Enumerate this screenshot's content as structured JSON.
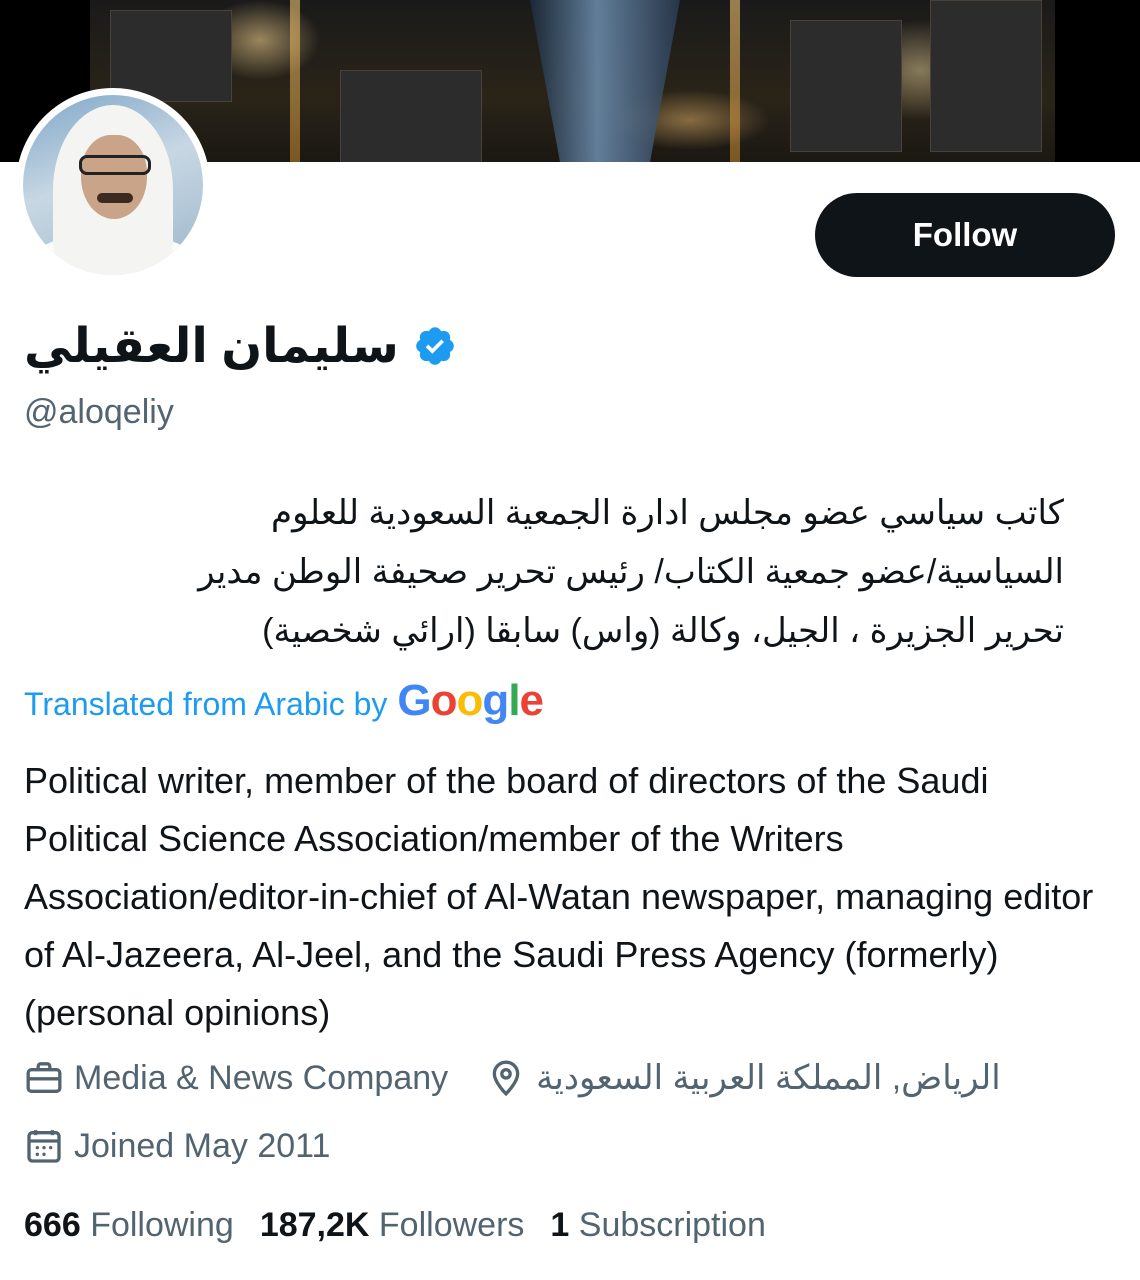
{
  "profile": {
    "display_name": "سليمان العقيلي",
    "handle": "@aloqeliy",
    "follow_label": "Follow",
    "bio_arabic_lines": [
      "كاتب سياسي عضو مجلس ادارة الجمعية السعودية للعلوم",
      "السياسية/عضو جمعية الكتاب/ رئيس تحرير صحيفة الوطن مدير",
      "تحرير الجزيرة ، الجيل، وكالة (واس) سابقا (ارائي شخصية)"
    ],
    "translated_label": "Translated from Arabic by",
    "translator_brand": [
      "G",
      "o",
      "o",
      "g",
      "l",
      "e"
    ],
    "bio_english": "Political writer, member of the board of directors of the Saudi Political Science Association/member of the Writers Association/editor-in-chief of Al-Watan newspaper, managing editor of Al-Jazeera, Al-Jeel, and the Saudi Press Agency (formerly) (personal opinions)",
    "category": "Media & News Company",
    "location": "الرياض, المملكة العربية السعودية",
    "joined": "Joined May 2011",
    "stats": {
      "following_count": "666",
      "following_label": "Following",
      "followers_count": "187,2K",
      "followers_label": "Followers",
      "subscriptions_count": "1",
      "subscriptions_label": "Subscription"
    }
  },
  "icons": {
    "verified": "verified-badge-icon",
    "category": "briefcase-icon",
    "location": "location-pin-icon",
    "joined": "calendar-icon"
  },
  "colors": {
    "accent": "#1d9bf0",
    "text_primary": "#0f1419",
    "text_secondary": "#536471",
    "button_bg": "#0f1419"
  }
}
